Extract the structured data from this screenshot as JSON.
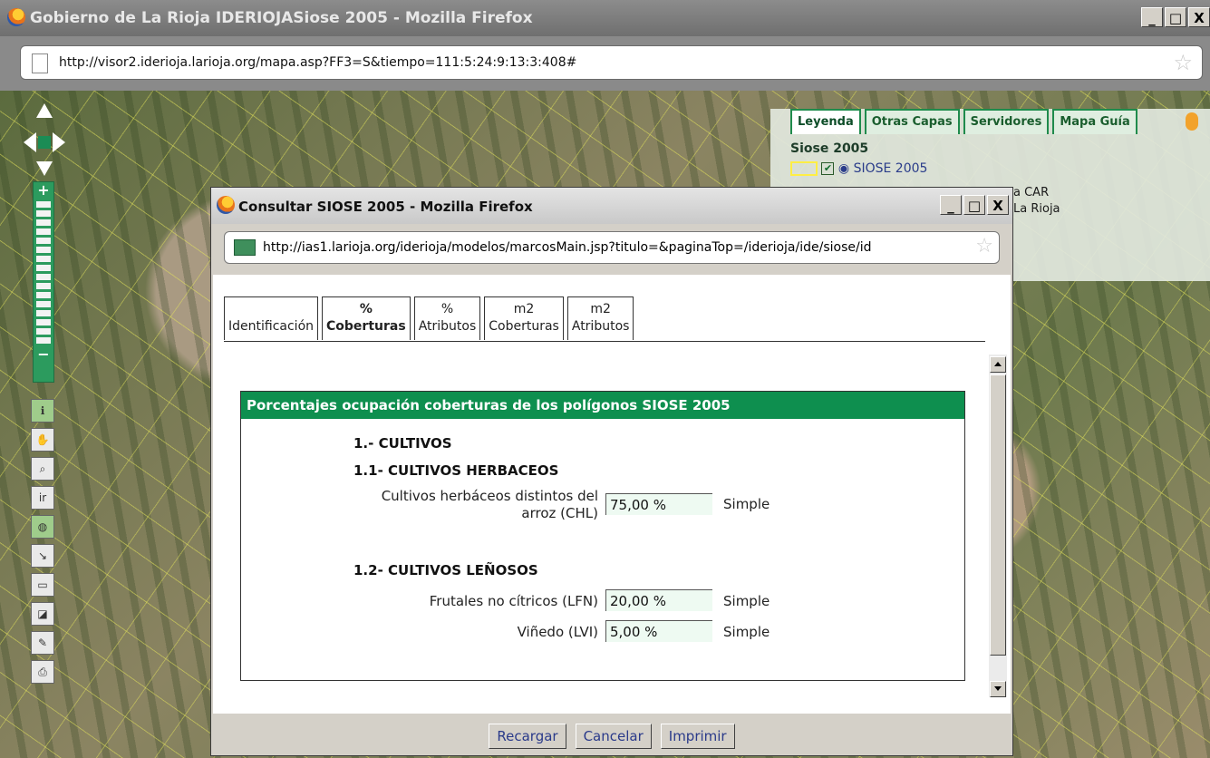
{
  "window": {
    "title": "Gobierno de La Rioja IDERIOJASiose 2005 - Mozilla Firefox",
    "url": "http://visor2.iderioja.larioja.org/mapa.asp?FF3=S&tiempo=111:5:24:9:13:3:408#",
    "controls": [
      "_",
      "□",
      "X"
    ]
  },
  "map_tools": {
    "zoom_in": "+",
    "zoom_out": "−",
    "tools": [
      "info-icon",
      "pan-icon",
      "zoom-box-icon",
      "ir-icon",
      "globe-icon",
      "measure-icon",
      "scale-icon",
      "layer-icon",
      "pen-icon",
      "print-icon"
    ],
    "ir_label": "ir"
  },
  "legend_panel": {
    "tabs": [
      "Leyenda",
      "Otras Capas",
      "Servidores",
      "Mapa Guía"
    ],
    "active_tab": "Leyenda",
    "heading": "Siose 2005",
    "layer_label": "SIOSE 2005",
    "side_text_1": "a CAR",
    "side_text_2": "La Rioja"
  },
  "popup": {
    "title": "Consultar SIOSE 2005 - Mozilla Firefox",
    "url": "http://ias1.larioja.org/iderioja/modelos/marcosMain.jsp?titulo=&paginaTop=/iderioja/ide/siose/id",
    "tabs": [
      {
        "top": "",
        "bottom": "Identificación"
      },
      {
        "top": "%",
        "bottom": "Coberturas"
      },
      {
        "top": "%",
        "bottom": "Atributos"
      },
      {
        "top": "m2",
        "bottom": "Coberturas"
      },
      {
        "top": "m2",
        "bottom": "Atributos"
      }
    ],
    "active_tab": "% Coberturas",
    "box_title": "Porcentajes ocupación coberturas de los polígonos SIOSE 2005",
    "section_1": "1.- CULTIVOS",
    "section_1_1": "1.1- CULTIVOS HERBACEOS",
    "row_chl": {
      "label_line1": "Cultivos herbáceos distintos del",
      "label_line2": "arroz (CHL)",
      "value": "75,00 %",
      "type": "Simple"
    },
    "section_1_2": "1.2- CULTIVOS LEÑOSOS",
    "row_lfn": {
      "label": "Frutales no cítricos (LFN)",
      "value": "20,00 %",
      "type": "Simple"
    },
    "row_lvi": {
      "label": "Viñedo (LVI)",
      "value": "5,00 %",
      "type": "Simple"
    },
    "buttons": {
      "reload": "Recargar",
      "cancel": "Cancelar",
      "print": "Imprimir"
    }
  }
}
